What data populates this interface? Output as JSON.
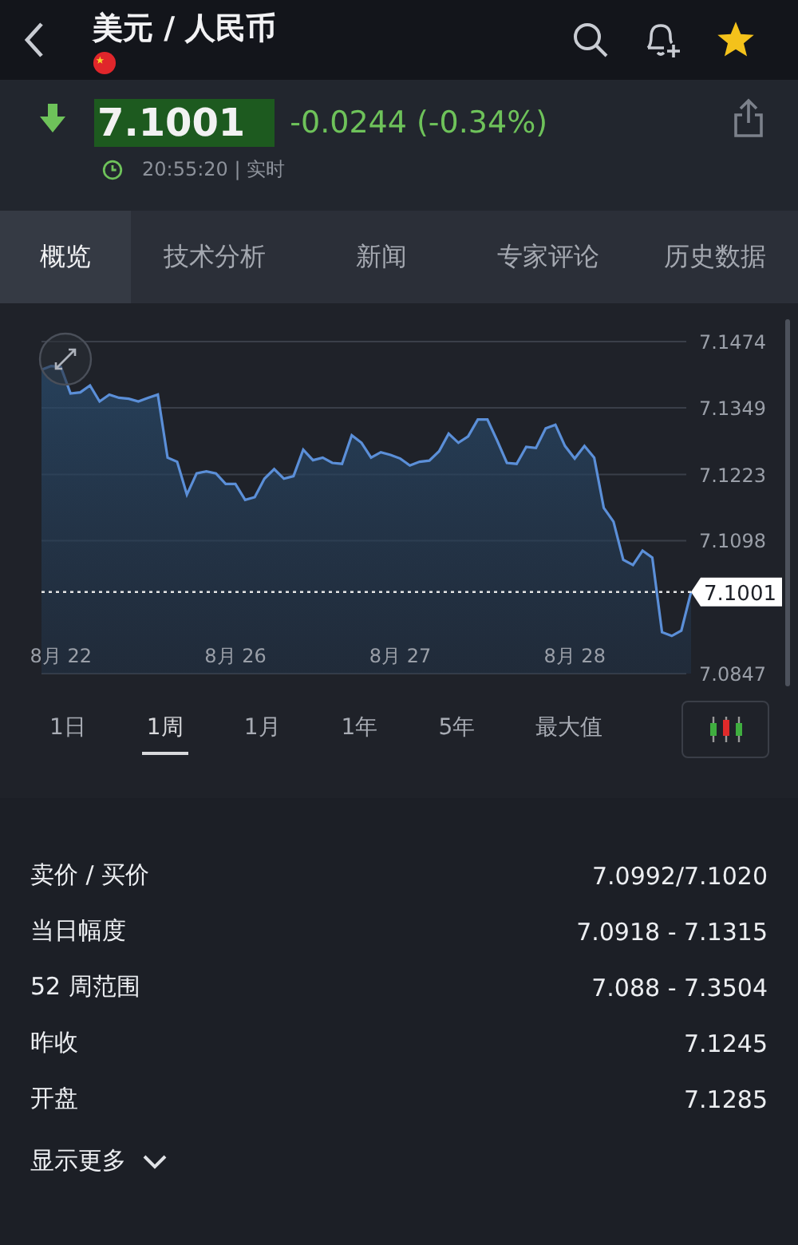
{
  "header": {
    "title": "美元 / 人民币"
  },
  "quote": {
    "price": "7.1001",
    "change": "-0.0244 (-0.34%)",
    "down": true,
    "time": "20:55:20 | 实时"
  },
  "tabs": [
    {
      "label": "概览",
      "selected": true
    },
    {
      "label": "技术分析",
      "selected": false
    },
    {
      "label": "新闻",
      "selected": false
    },
    {
      "label": "专家评论",
      "selected": false
    },
    {
      "label": "历史数据",
      "selected": false
    }
  ],
  "chart_data": {
    "type": "area",
    "grid": true,
    "ylim": [
      7.0847,
      7.1474
    ],
    "yticks": [
      7.1474,
      7.1349,
      7.1223,
      7.1098,
      7.0847
    ],
    "categories": [
      null,
      null,
      "8月 22",
      null,
      null,
      null,
      null,
      null,
      null,
      null,
      null,
      null,
      null,
      null,
      null,
      null,
      null,
      null,
      null,
      null,
      "8月 26",
      null,
      null,
      null,
      null,
      null,
      null,
      null,
      null,
      null,
      null,
      null,
      null,
      null,
      null,
      null,
      null,
      "8月 27",
      null,
      null,
      null,
      null,
      null,
      null,
      null,
      null,
      null,
      null,
      null,
      null,
      null,
      null,
      null,
      null,
      null,
      "8月 28",
      null,
      null,
      null,
      null,
      null,
      null,
      null,
      null,
      null,
      null,
      null,
      null
    ],
    "series": [
      {
        "color": "#5b8fd8",
        "values": [
          7.1421,
          7.1428,
          7.1426,
          7.1376,
          7.1378,
          7.1391,
          7.1361,
          7.1374,
          7.1368,
          7.1366,
          7.1361,
          7.1368,
          7.1374,
          7.1255,
          7.1247,
          7.1185,
          7.1225,
          7.1229,
          7.1225,
          7.1205,
          7.1205,
          7.1175,
          7.118,
          7.1215,
          7.1233,
          7.1215,
          7.122,
          7.127,
          7.125,
          7.1255,
          7.1245,
          7.1243,
          7.1297,
          7.1283,
          7.1255,
          7.1265,
          7.126,
          7.1253,
          7.124,
          7.1247,
          7.1249,
          7.1267,
          7.13,
          7.1283,
          7.1295,
          7.1327,
          7.1327,
          7.1287,
          7.1245,
          7.1243,
          7.1275,
          7.1273,
          7.131,
          7.1317,
          7.1277,
          7.1253,
          7.1277,
          7.1255,
          7.116,
          7.1134,
          7.1062,
          7.1052,
          7.1079,
          7.1066,
          7.0925,
          7.0918,
          7.0928,
          7.1001
        ]
      }
    ]
  },
  "price_marker": {
    "label": "7.1001"
  },
  "ranges": [
    {
      "label": "1日",
      "selected": false
    },
    {
      "label": "1周",
      "selected": true
    },
    {
      "label": "1月",
      "selected": false
    },
    {
      "label": "1年",
      "selected": false
    },
    {
      "label": "5年",
      "selected": false
    },
    {
      "label": "最大值",
      "selected": false
    }
  ],
  "stats": [
    {
      "label": "卖价 / 买价",
      "value": "7.0992/7.1020"
    },
    {
      "label": "当日幅度",
      "value": "7.0918 - 7.1315"
    },
    {
      "label": "52 周范围",
      "value": "7.088 - 7.3504"
    },
    {
      "label": "昨收",
      "value": "7.1245"
    },
    {
      "label": "开盘",
      "value": "7.1285"
    }
  ],
  "show_more": "显示更多"
}
